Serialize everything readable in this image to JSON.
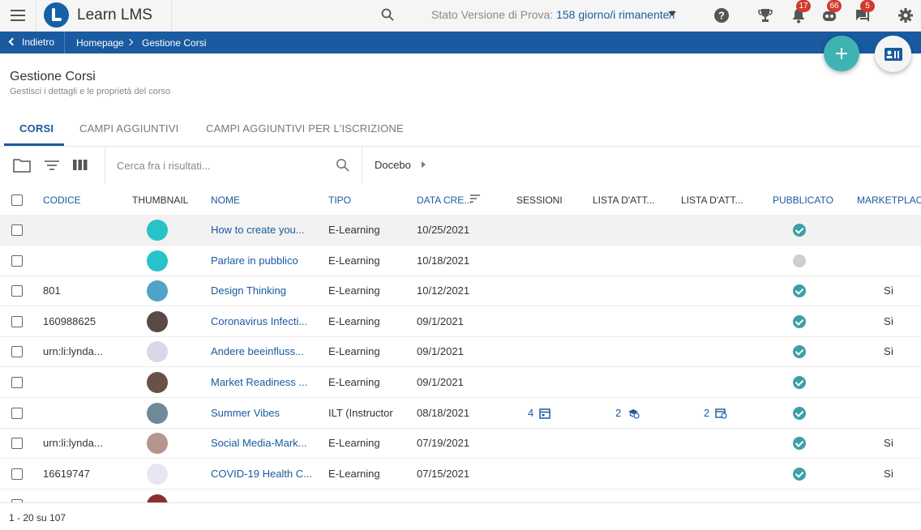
{
  "app": {
    "title": "Learn LMS",
    "trial_prefix": "Stato Versione di Prova: ",
    "trial_days": "158 giorno/i rimanente/i",
    "badges": {
      "notifications": "17",
      "gamification": "66",
      "messages": "5"
    }
  },
  "breadcrumb": {
    "back": "Indietro",
    "home": "Homepage",
    "current": "Gestione Corsi"
  },
  "page": {
    "title": "Gestione Corsi",
    "subtitle": "Gestisci i dettagli e le proprietà del corso"
  },
  "tabs": [
    {
      "label": "CORSI",
      "active": true
    },
    {
      "label": "CAMPI AGGIUNTIVI",
      "active": false
    },
    {
      "label": "CAMPI AGGIUNTIVI PER L'ISCRIZIONE",
      "active": false
    }
  ],
  "toolbar": {
    "search_placeholder": "Cerca fra i risultati...",
    "catalog_filter": "Docebo"
  },
  "table": {
    "columns": {
      "code": "CODICE",
      "thumbnail": "THUMBNAIL",
      "name": "NOME",
      "type": "TIPO",
      "date": "DATA CRE...",
      "sessions": "SESSIONI",
      "waitlist1": "LISTA D'ATT...",
      "waitlist2": "LISTA D'ATT...",
      "published": "PUBBLICATO",
      "marketplace": "MARKETPLACE"
    },
    "rows": [
      {
        "code": "",
        "name": "How to create you...",
        "type": "E-Learning",
        "date": "10/25/2021",
        "sessions": "",
        "wait1": "",
        "wait2": "",
        "published": true,
        "marketplace": "",
        "thumb": "#28c2c9"
      },
      {
        "code": "",
        "name": "Parlare in pubblico",
        "type": "E-Learning",
        "date": "10/18/2021",
        "sessions": "",
        "wait1": "",
        "wait2": "",
        "published": false,
        "marketplace": "",
        "thumb": "#28c2c9"
      },
      {
        "code": "801",
        "name": "Design Thinking",
        "type": "E-Learning",
        "date": "10/12/2021",
        "sessions": "",
        "wait1": "",
        "wait2": "",
        "published": true,
        "marketplace": "Sì",
        "thumb": "#4fa3c7"
      },
      {
        "code": "160988625",
        "name": "Coronavirus Infecti...",
        "type": "E-Learning",
        "date": "09/1/2021",
        "sessions": "",
        "wait1": "",
        "wait2": "",
        "published": true,
        "marketplace": "Sì",
        "thumb": "#5a4a45"
      },
      {
        "code": "urn:li:lynda...",
        "name": "Andere beeinfluss...",
        "type": "E-Learning",
        "date": "09/1/2021",
        "sessions": "",
        "wait1": "",
        "wait2": "",
        "published": true,
        "marketplace": "Sì",
        "thumb": "#d8d8e6"
      },
      {
        "code": "",
        "name": "Market Readiness ...",
        "type": "E-Learning",
        "date": "09/1/2021",
        "sessions": "",
        "wait1": "",
        "wait2": "",
        "published": true,
        "marketplace": "",
        "thumb": "#6b5048"
      },
      {
        "code": "",
        "name": "Summer Vibes",
        "type": "ILT (Instructor",
        "date": "08/18/2021",
        "sessions": "4",
        "wait1": "2",
        "wait2": "2",
        "published": true,
        "marketplace": "",
        "thumb": "#6d8a99"
      },
      {
        "code": "urn:li:lynda...",
        "name": "Social Media-Mark...",
        "type": "E-Learning",
        "date": "07/19/2021",
        "sessions": "",
        "wait1": "",
        "wait2": "",
        "published": true,
        "marketplace": "Sì",
        "thumb": "#b5958e"
      },
      {
        "code": "16619747",
        "name": "COVID-19 Health C...",
        "type": "E-Learning",
        "date": "07/15/2021",
        "sessions": "",
        "wait1": "",
        "wait2": "",
        "published": true,
        "marketplace": "Sì",
        "thumb": "#e9e6f1"
      }
    ]
  },
  "footer": {
    "pagination": "1 - 20 su 107"
  },
  "colors": {
    "brand_blue": "#1a5aa0",
    "teal": "#3fb3b2"
  }
}
